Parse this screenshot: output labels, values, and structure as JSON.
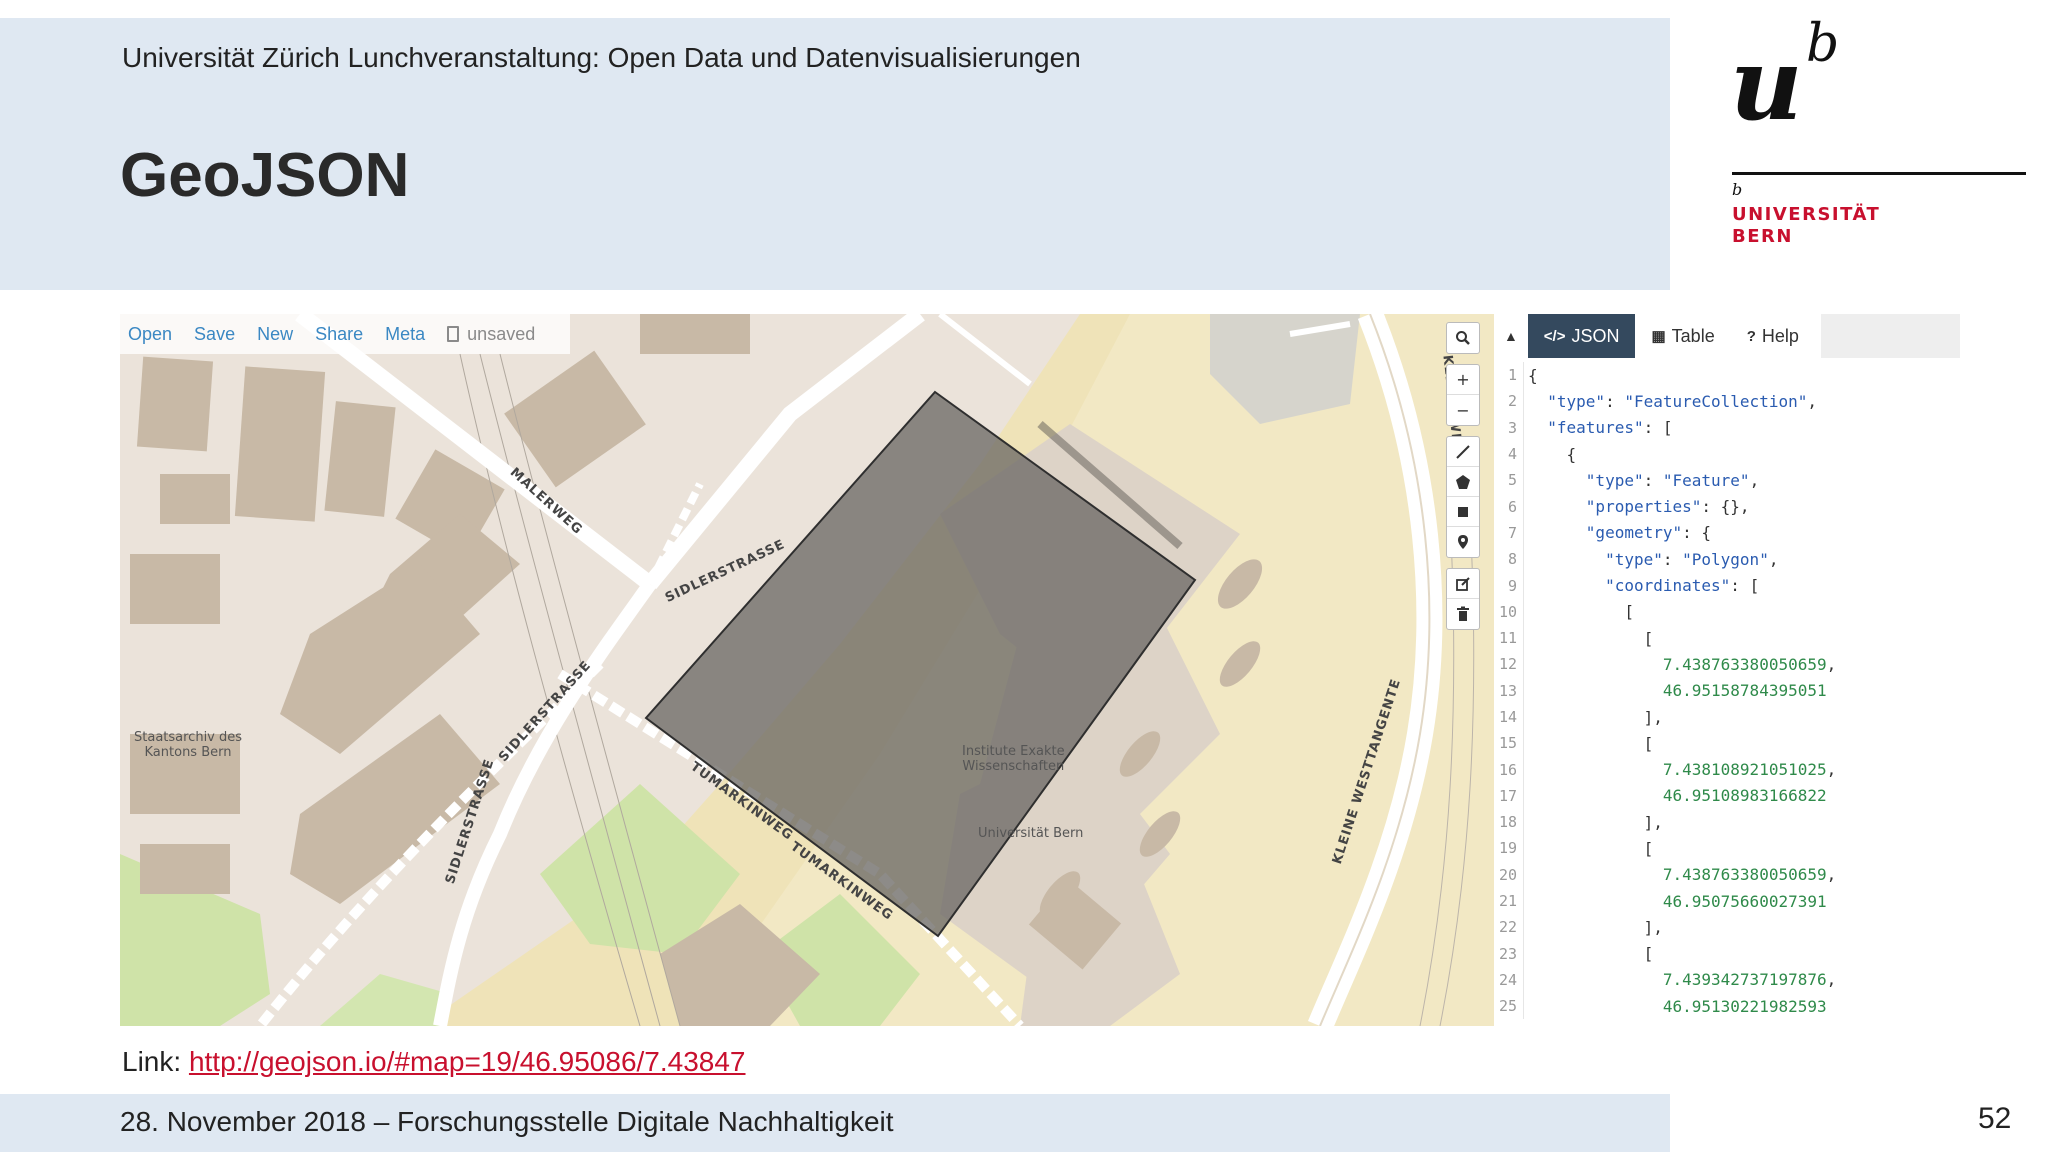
{
  "slide": {
    "subtitle": "Universität Zürich Lunchveranstaltung: Open Data und Datenvisualisierungen",
    "title": "GeoJSON",
    "link_label": "Link: ",
    "link_url": "http://geojson.io/#map=19/46.95086/7.43847",
    "footer": "28. November 2018 – Forschungsstelle Digitale Nachhaltigkeit",
    "page_number": "52"
  },
  "logo": {
    "mark": "u",
    "mark_sup": "b",
    "small_b": "b",
    "line1": "UNIVERSITÄT",
    "line2": "BERN",
    "color": "#c8102e"
  },
  "toolbar": {
    "open": "Open",
    "save": "Save",
    "new": "New",
    "share": "Share",
    "meta": "Meta",
    "status": "unsaved"
  },
  "map": {
    "labels": {
      "archive": "Staatsarchiv des",
      "archive2": "Kantons Bern",
      "institute": "Institute Exakte",
      "institute2": "Wissenschaften",
      "university": "Universität Bern"
    },
    "streets": {
      "malerweg": "MALERWEG",
      "sidler1": "SIDLERSTRASSE",
      "sidler2": "SIDLERSTRASSE",
      "sidler3": "SIDLERSTRASSE",
      "tumarkin1": "TUMARKINWEG",
      "tumarkin2": "TUMARKINWEG",
      "westtangente1": "KLEINE WESTTANGENTE",
      "westtangente2": "KLEINE WESTTANGENTE"
    }
  },
  "controls": {
    "search_icon": "search-icon",
    "zoom_in": "+",
    "zoom_out": "−"
  },
  "panel": {
    "collapse": "▲",
    "tabs": [
      "JSON",
      "Table",
      "Help"
    ]
  },
  "code_lines": [
    "{",
    "  \"type\": \"FeatureCollection\",",
    "  \"features\": [",
    "    {",
    "      \"type\": \"Feature\",",
    "      \"properties\": {},",
    "      \"geometry\": {",
    "        \"type\": \"Polygon\",",
    "        \"coordinates\": [",
    "          [",
    "            [",
    "              7.438763380050659,",
    "              46.95158784395051",
    "            ],",
    "            [",
    "              7.438108921051025,",
    "              46.95108983166822",
    "            ],",
    "            [",
    "              7.438763380050659,",
    "              46.95075660027391",
    "            ],",
    "            [",
    "              7.439342737197876,",
    "              46.95130221982593"
  ]
}
